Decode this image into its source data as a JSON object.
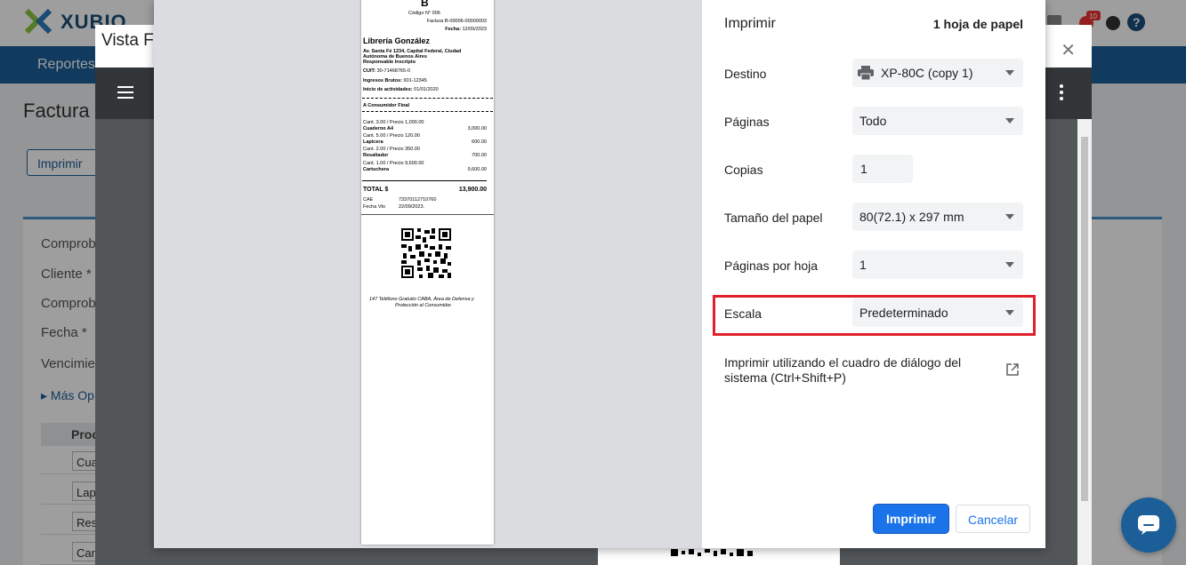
{
  "app": {
    "logo_text": "XUBIO",
    "notification_count": "10",
    "nav_item": "Reportes",
    "page_title": "Factura",
    "print_button": "Imprimir",
    "form_labels": [
      "Comprob",
      "Cliente *",
      "Comprob",
      "Fecha *",
      "Vencimie"
    ],
    "more_options": "Más Op",
    "table_header": "Proc",
    "table_rows": [
      "Cua",
      "Lap",
      "Res",
      "Car"
    ]
  },
  "vista_previa": {
    "title": "Vista F"
  },
  "receipt": {
    "letter": "B",
    "codigo": "Código N° 006",
    "factura": "Factura B-00006-00000003",
    "fecha_label": "Fecha:",
    "fecha": "12/09/2023",
    "business_name": "Librería González",
    "address1": "Av. Santa Fé 1234, Capital Federal, Ciudad",
    "address2": "Autónoma de Buenos Aires",
    "iva": "Responsable Inscripto",
    "cuit_label": "CUIT:",
    "cuit": "30-71468765-0",
    "ib_label": "Ingresos Brutos:",
    "ib": "901-12345",
    "inicio_label": "Inicio de actividades:",
    "inicio": "01/01/2020",
    "consumer": "A Consumidor Final",
    "items": [
      {
        "qty": "Cant. 3.00 / Precio 1,000.00",
        "name": "Cuaderno A4",
        "total": "3,000.00"
      },
      {
        "qty": "Cant. 5.00 / Precio 120.00",
        "name": "Lapicera",
        "total": "600.00"
      },
      {
        "qty": "Cant. 2.00 / Precio 350.00",
        "name": "Resaltador",
        "total": "700.00"
      },
      {
        "qty": "Cant. 1.00 / Precio 9,600.00",
        "name": "Cartuchera",
        "total": "9,600.00"
      }
    ],
    "total_label": "TOTAL $",
    "total": "13,900.00",
    "cae_label": "CAE",
    "cae": "73370112710760",
    "vto_label": "Fecha Vto",
    "vto": "22/09/2023.",
    "footer1": "147 Teléfono Gratuito CABA, Área de Defensa y",
    "footer2": "Protección al Consumidor."
  },
  "print": {
    "title": "Imprimir",
    "sheets": "1 hoja de papel",
    "destino_label": "Destino",
    "destino_value": "XP-80C (copy 1)",
    "paginas_label": "Páginas",
    "paginas_value": "Todo",
    "copias_label": "Copias",
    "copias_value": "1",
    "tamano_label": "Tamaño del papel",
    "tamano_value": "80(72.1) x 297 mm",
    "por_hoja_label": "Páginas por hoja",
    "por_hoja_value": "1",
    "escala_label": "Escala",
    "escala_value": "Predeterminado",
    "system_dialog": "Imprimir utilizando el cuadro de diálogo del sistema (Ctrl+Shift+P)",
    "print_button": "Imprimir",
    "cancel_button": "Cancelar"
  },
  "colors": {
    "highlight": "#e0202a",
    "primary": "#1a73e8",
    "app_blue": "#1b5e98"
  }
}
